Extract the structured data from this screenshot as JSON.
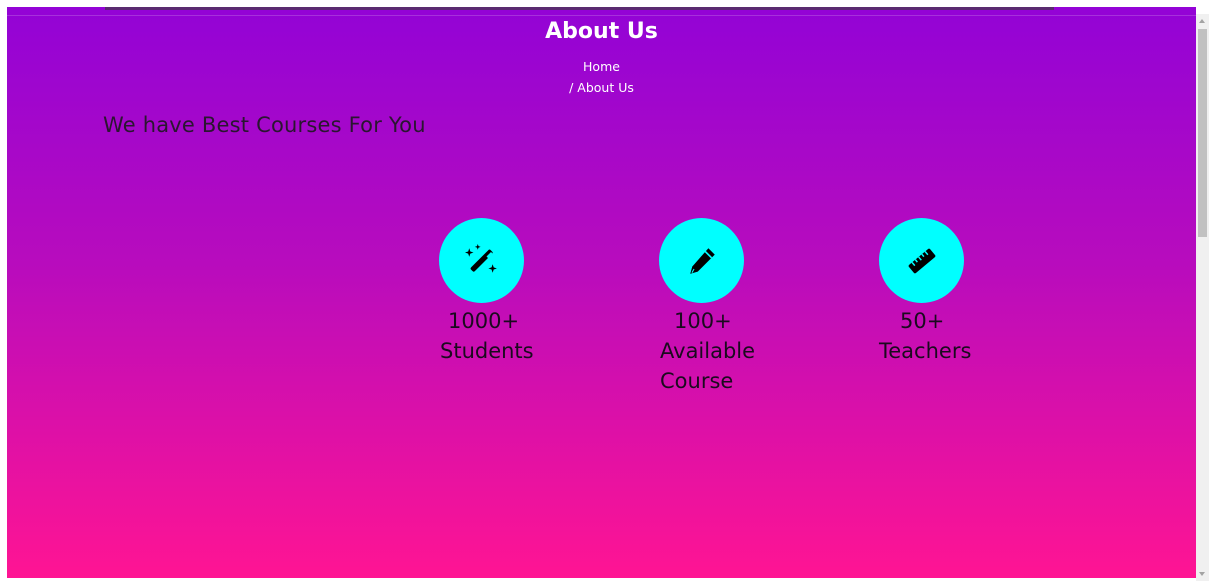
{
  "header": {
    "title": "About Us",
    "breadcrumb": {
      "home": "Home",
      "current": "/ About Us"
    }
  },
  "main": {
    "heading": "We have Best Courses For You",
    "stats": [
      {
        "icon": "magic-wand-icon",
        "count": "1000+",
        "label": "Students"
      },
      {
        "icon": "pencil-icon",
        "count": "100+",
        "label": "Available Course"
      },
      {
        "icon": "ruler-icon",
        "count": "50+",
        "label": "Teachers"
      }
    ]
  },
  "colors": {
    "gradient_top": "#9303d6",
    "gradient_bottom": "#ff1493",
    "icon_circle": "#00ffff"
  }
}
